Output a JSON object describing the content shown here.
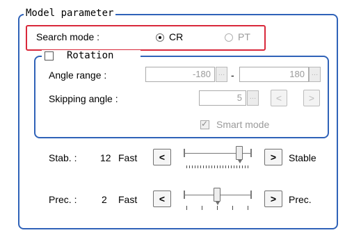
{
  "model_parameter": {
    "legend": "Model parameter",
    "search_mode": {
      "label": "Search mode :",
      "options": [
        {
          "label": "CR",
          "selected": true
        },
        {
          "label": "PT",
          "selected": false
        }
      ]
    },
    "rotation": {
      "legend": "Rotation",
      "checked": false,
      "angle_range": {
        "label": "Angle range :",
        "from": "-180",
        "separator": "-",
        "to": "180"
      },
      "skipping_angle": {
        "label": "Skipping angle :",
        "value": "5",
        "prev_label": "<",
        "next_label": ">"
      },
      "smart_mode": {
        "label": "Smart mode",
        "checked": true
      }
    },
    "stab": {
      "label": "Stab. :",
      "value": "12",
      "low_label": "Fast",
      "high_label": "Stable",
      "dec_label": "<",
      "inc_label": ">",
      "level": 0.85
    },
    "prec": {
      "label": "Prec. :",
      "value": "2",
      "low_label": "Fast",
      "high_label": "Prec.",
      "dec_label": "<",
      "inc_label": ">",
      "level": 0.5
    }
  }
}
